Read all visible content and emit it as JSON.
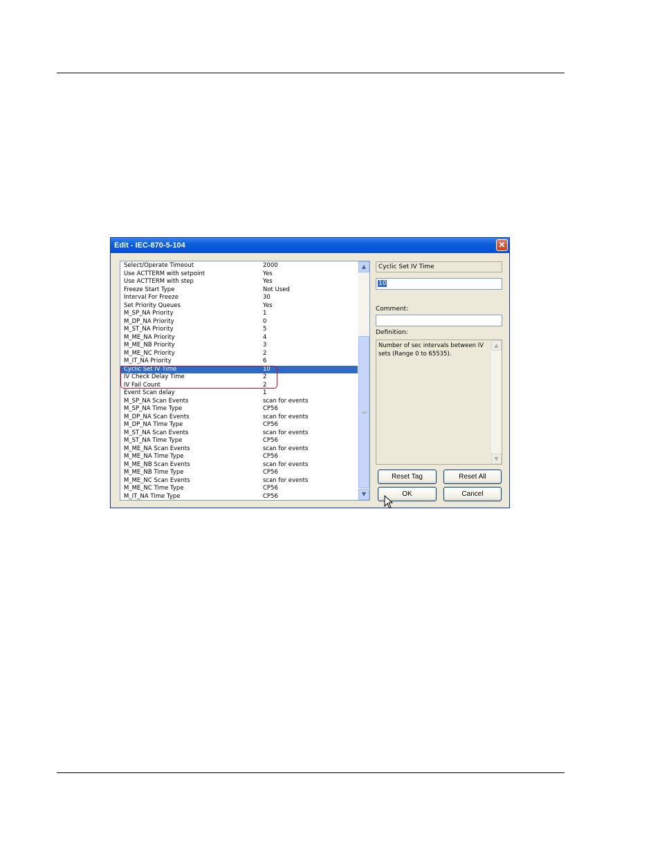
{
  "dialog": {
    "title": "Edit - IEC-870-5-104",
    "close_glyph": "✕"
  },
  "parameters": [
    {
      "name": "Select/Operate Timeout",
      "value": "2000"
    },
    {
      "name": "Use ACTTERM with setpoint",
      "value": "Yes"
    },
    {
      "name": "Use ACTTERM with step",
      "value": "Yes"
    },
    {
      "name": "Freeze Start Type",
      "value": "Not Used"
    },
    {
      "name": "Interval For Freeze",
      "value": "30"
    },
    {
      "name": "Set Priority Queues",
      "value": "Yes"
    },
    {
      "name": "M_SP_NA Priority",
      "value": "1"
    },
    {
      "name": "M_DP_NA Priority",
      "value": "0"
    },
    {
      "name": "M_ST_NA Priority",
      "value": "5"
    },
    {
      "name": "M_ME_NA Priority",
      "value": "4"
    },
    {
      "name": "M_ME_NB Priority",
      "value": "3"
    },
    {
      "name": "M_ME_NC Priority",
      "value": "2"
    },
    {
      "name": "M_IT_NA Priority",
      "value": "6"
    },
    {
      "name": "Cyclic Set IV Time",
      "value": "10"
    },
    {
      "name": "IV Check Delay Time",
      "value": "2"
    },
    {
      "name": "IV Fail Count",
      "value": "2"
    },
    {
      "name": "Event Scan delay",
      "value": "1"
    },
    {
      "name": "M_SP_NA Scan Events",
      "value": "scan for events"
    },
    {
      "name": "M_SP_NA Time Type",
      "value": "CP56"
    },
    {
      "name": "M_DP_NA Scan Events",
      "value": "scan for events"
    },
    {
      "name": "M_DP_NA Time Type",
      "value": "CP56"
    },
    {
      "name": "M_ST_NA Scan Events",
      "value": "scan for events"
    },
    {
      "name": "M_ST_NA Time Type",
      "value": "CP56"
    },
    {
      "name": "M_ME_NA Scan Events",
      "value": "scan for events"
    },
    {
      "name": "M_ME_NA Time Type",
      "value": "CP56"
    },
    {
      "name": "M_ME_NB Scan Events",
      "value": "scan for events"
    },
    {
      "name": "M_ME_NB Time Type",
      "value": "CP56"
    },
    {
      "name": "M_ME_NC Scan Events",
      "value": "scan for events"
    },
    {
      "name": "M_ME_NC Time Type",
      "value": "CP56"
    },
    {
      "name": "M_IT_NA Time Type",
      "value": "CP56"
    }
  ],
  "selected_index": 13,
  "scroll_glyphs": {
    "up": "▲",
    "down": "▼"
  },
  "editor": {
    "tag_name": "Cyclic Set IV Time",
    "value": "10",
    "comment_label": "Comment:",
    "comment_value": "",
    "definition_label": "Definition:",
    "definition_text": "Number of sec intervals between IV sets (Range 0 to 65535)."
  },
  "buttons": {
    "reset_tag": "Reset Tag",
    "reset_all": "Reset All",
    "ok": "OK",
    "cancel": "Cancel"
  },
  "colors": {
    "selection": "#316ac5",
    "highlight_outline": "#e0001a",
    "titlebar": "#0855dd"
  }
}
